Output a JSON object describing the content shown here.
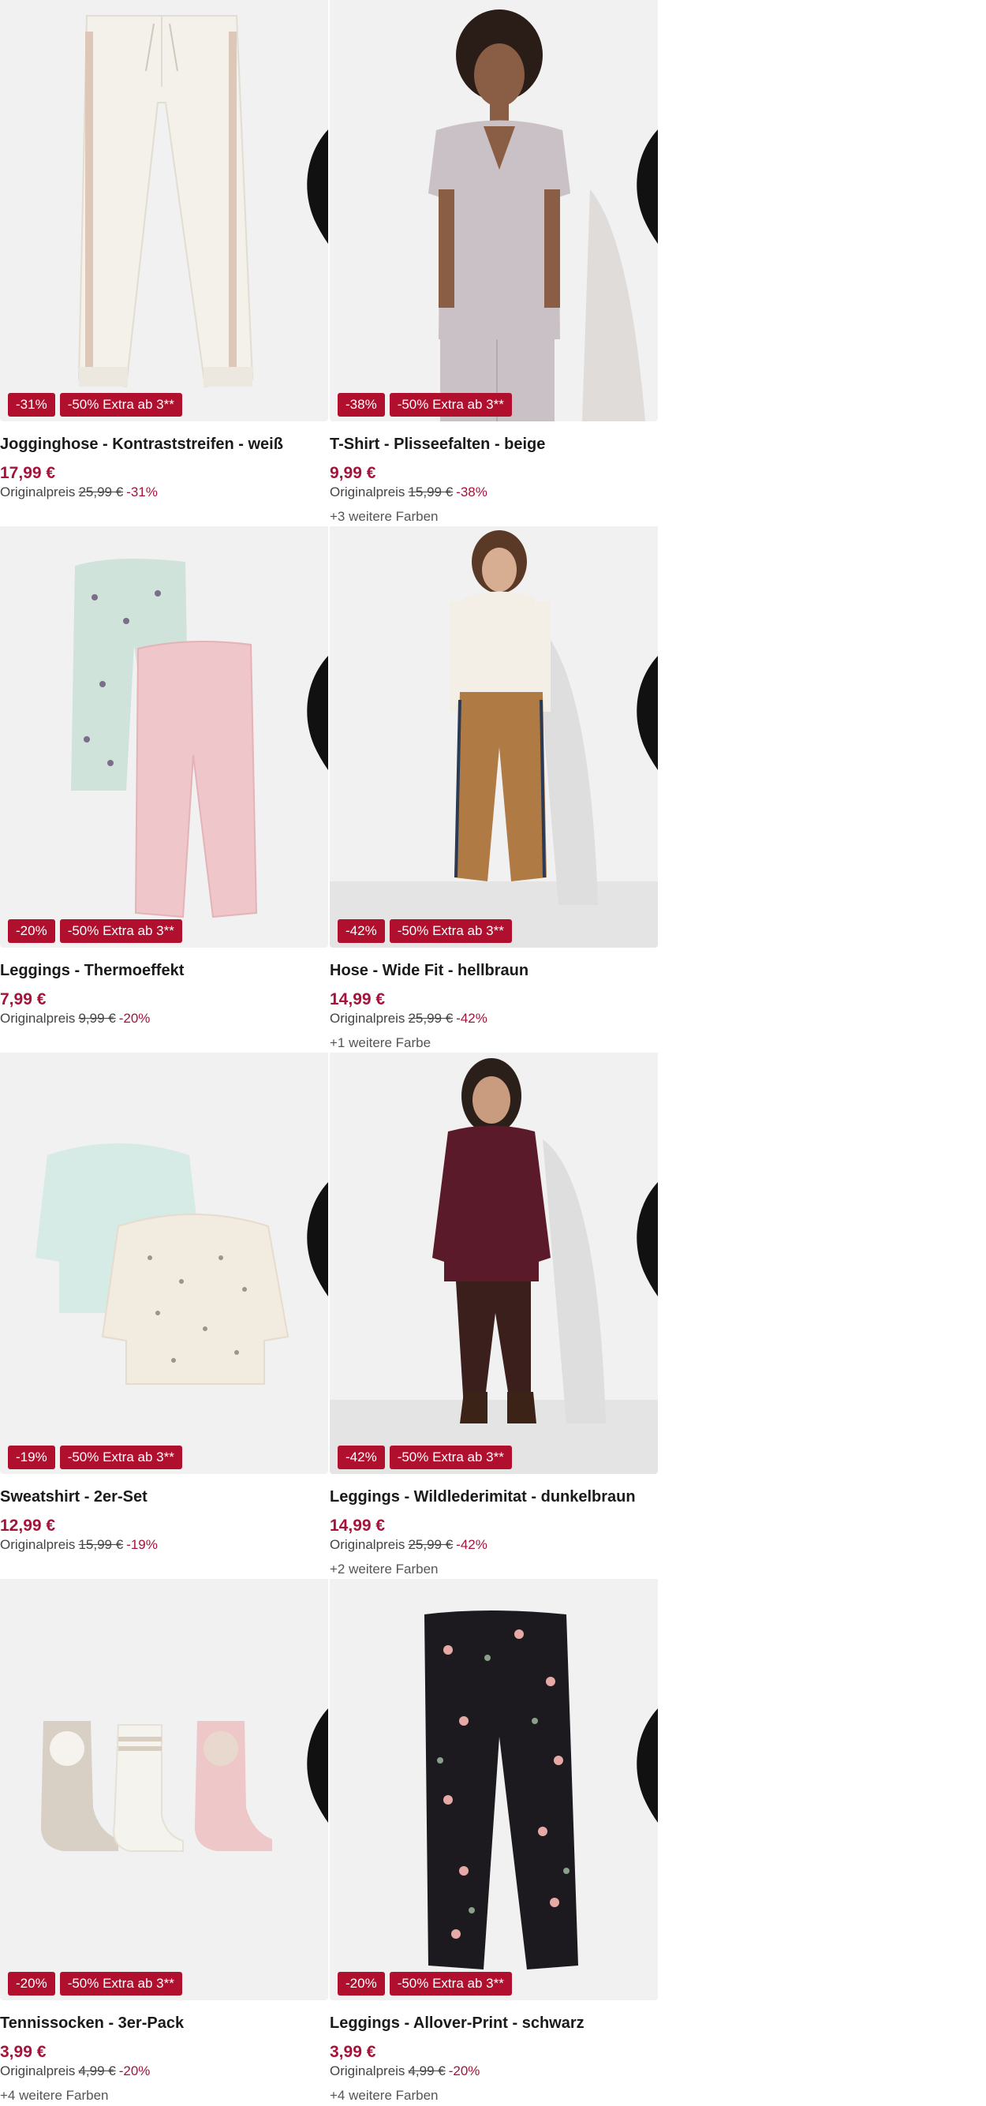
{
  "colors": {
    "accent": "#a5123a",
    "badge": "#b0102e",
    "image_bg": "#f1f1f1"
  },
  "products": [
    {
      "title": "Jogginghose - Kontraststreifen - weiß",
      "price": "17,99 €",
      "orig_label": "Originalpreis",
      "orig_price": "25,99 €",
      "discount": "-31%",
      "badge_discount": "-31%",
      "badge_promo": "-50% Extra ab 3**",
      "more_colors": "",
      "image": "white-jogging-pants"
    },
    {
      "title": "T-Shirt - Plisseefalten - beige",
      "price": "9,99 €",
      "orig_label": "Originalpreis",
      "orig_price": "15,99 €",
      "discount": "-38%",
      "badge_discount": "-38%",
      "badge_promo": "-50% Extra ab 3**",
      "more_colors": "+3 weitere Farben",
      "image": "model-beige-pleated-shirt"
    },
    {
      "title": "Leggings - Thermoeffekt",
      "price": "7,99 €",
      "orig_label": "Originalpreis",
      "orig_price": "9,99 €",
      "discount": "-20%",
      "badge_discount": "-20%",
      "badge_promo": "-50% Extra ab 3**",
      "more_colors": "",
      "image": "kids-leggings-mint-pink"
    },
    {
      "title": "Hose - Wide Fit - hellbraun",
      "price": "14,99 €",
      "orig_label": "Originalpreis",
      "orig_price": "25,99 €",
      "discount": "-42%",
      "badge_discount": "-42%",
      "badge_promo": "-50% Extra ab 3**",
      "more_colors": "+1 weitere Farbe",
      "image": "model-brown-wide-pants"
    },
    {
      "title": "Sweatshirt - 2er-Set",
      "price": "12,99 €",
      "orig_label": "Originalpreis",
      "orig_price": "15,99 €",
      "discount": "-19%",
      "badge_discount": "-19%",
      "badge_promo": "-50% Extra ab 3**",
      "more_colors": "",
      "image": "kids-sweatshirts-set"
    },
    {
      "title": "Leggings - Wildlederimitat - dunkelbraun",
      "price": "14,99 €",
      "orig_label": "Originalpreis",
      "orig_price": "25,99 €",
      "discount": "-42%",
      "badge_discount": "-42%",
      "badge_promo": "-50% Extra ab 3**",
      "more_colors": "+2 weitere Farben",
      "image": "model-burgundy-sweater-leggings"
    },
    {
      "title": "Tennissocken - 3er-Pack",
      "price": "3,99 €",
      "orig_label": "Originalpreis",
      "orig_price": "4,99 €",
      "discount": "-20%",
      "badge_discount": "-20%",
      "badge_promo": "-50% Extra ab 3**",
      "more_colors": "+4 weitere Farben",
      "image": "kids-socks-three-pack"
    },
    {
      "title": "Leggings - Allover-Print - schwarz",
      "price": "3,99 €",
      "orig_label": "Originalpreis",
      "orig_price": "4,99 €",
      "discount": "-20%",
      "badge_discount": "-20%",
      "badge_promo": "-50% Extra ab 3**",
      "more_colors": "+4 weitere Farben",
      "image": "kids-black-floral-leggings"
    }
  ]
}
